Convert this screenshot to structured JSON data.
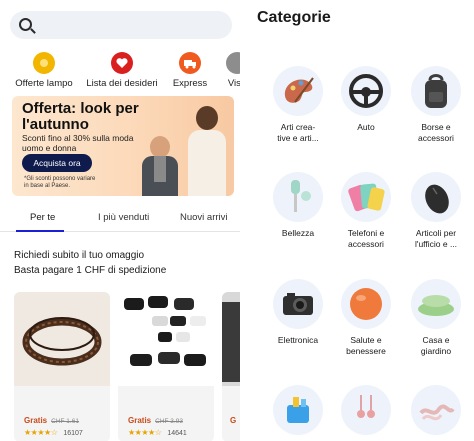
{
  "search": {
    "placeholder": ""
  },
  "quick_actions": [
    {
      "label": "Offerte lampo",
      "icon": "flash-deal-icon",
      "color": "#f2b600"
    },
    {
      "label": "Lista dei desideri",
      "icon": "heart-icon",
      "color": "#d9201e"
    },
    {
      "label": "Express",
      "icon": "express-icon",
      "color": "#f05a1e"
    },
    {
      "label": "Visu",
      "icon": "visual-icon",
      "color": "#8d8d8d"
    }
  ],
  "banner": {
    "title": "Offerta: look per l'autunno",
    "subtitle": "Sconti fino al 30% sulla moda uomo e donna",
    "cta": "Acquista ora",
    "note": "*Gli sconti possono variare in base al Paese."
  },
  "tabs": [
    "Per te",
    "I più venduti",
    "Nuovi arrivi"
  ],
  "active_tab": "Per te",
  "promo": {
    "title": "Richiedi subito il tuo omaggio",
    "subtitle": "Basta pagare 1 CHF di spedizione"
  },
  "products": [
    {
      "price_label": "Gratis",
      "old_price": "CHF 1.61",
      "reviews": "16107",
      "rating_stars": 4.5
    },
    {
      "price_label": "Gratis",
      "old_price": "CHF 3.93",
      "reviews": "14641",
      "rating_stars": 4.5
    },
    {
      "price_label": "G",
      "old_price": "",
      "reviews": "",
      "rating_stars": 0
    }
  ],
  "categories_title": "Categorie",
  "categories": [
    {
      "label": "Arti crea-\ntive e arti...",
      "icon": "art-palette-icon"
    },
    {
      "label": "Auto",
      "icon": "steering-wheel-icon"
    },
    {
      "label": "Borse e\naccessori",
      "icon": "backpack-icon"
    },
    {
      "label": "Bellezza",
      "icon": "beauty-roller-icon"
    },
    {
      "label": "Telefoni e\naccessori",
      "icon": "phone-accessories-icon"
    },
    {
      "label": "Articoli per\nl'ufficio e ...",
      "icon": "mouse-icon"
    },
    {
      "label": "Elettronica",
      "icon": "camera-icon"
    },
    {
      "label": "Salute e\nbenessere",
      "icon": "fitness-ball-icon"
    },
    {
      "label": "Casa e\ngiardino",
      "icon": "cushions-icon"
    },
    {
      "label": "",
      "icon": "cleaning-supplies-icon"
    },
    {
      "label": "",
      "icon": "jewelry-icon"
    },
    {
      "label": "",
      "icon": "lace-icon"
    }
  ],
  "colors": {
    "accent": "#1c1fd6",
    "cta_bg": "#0f1b4d",
    "gratis": "#c64a1a",
    "star": "#e8a300"
  }
}
